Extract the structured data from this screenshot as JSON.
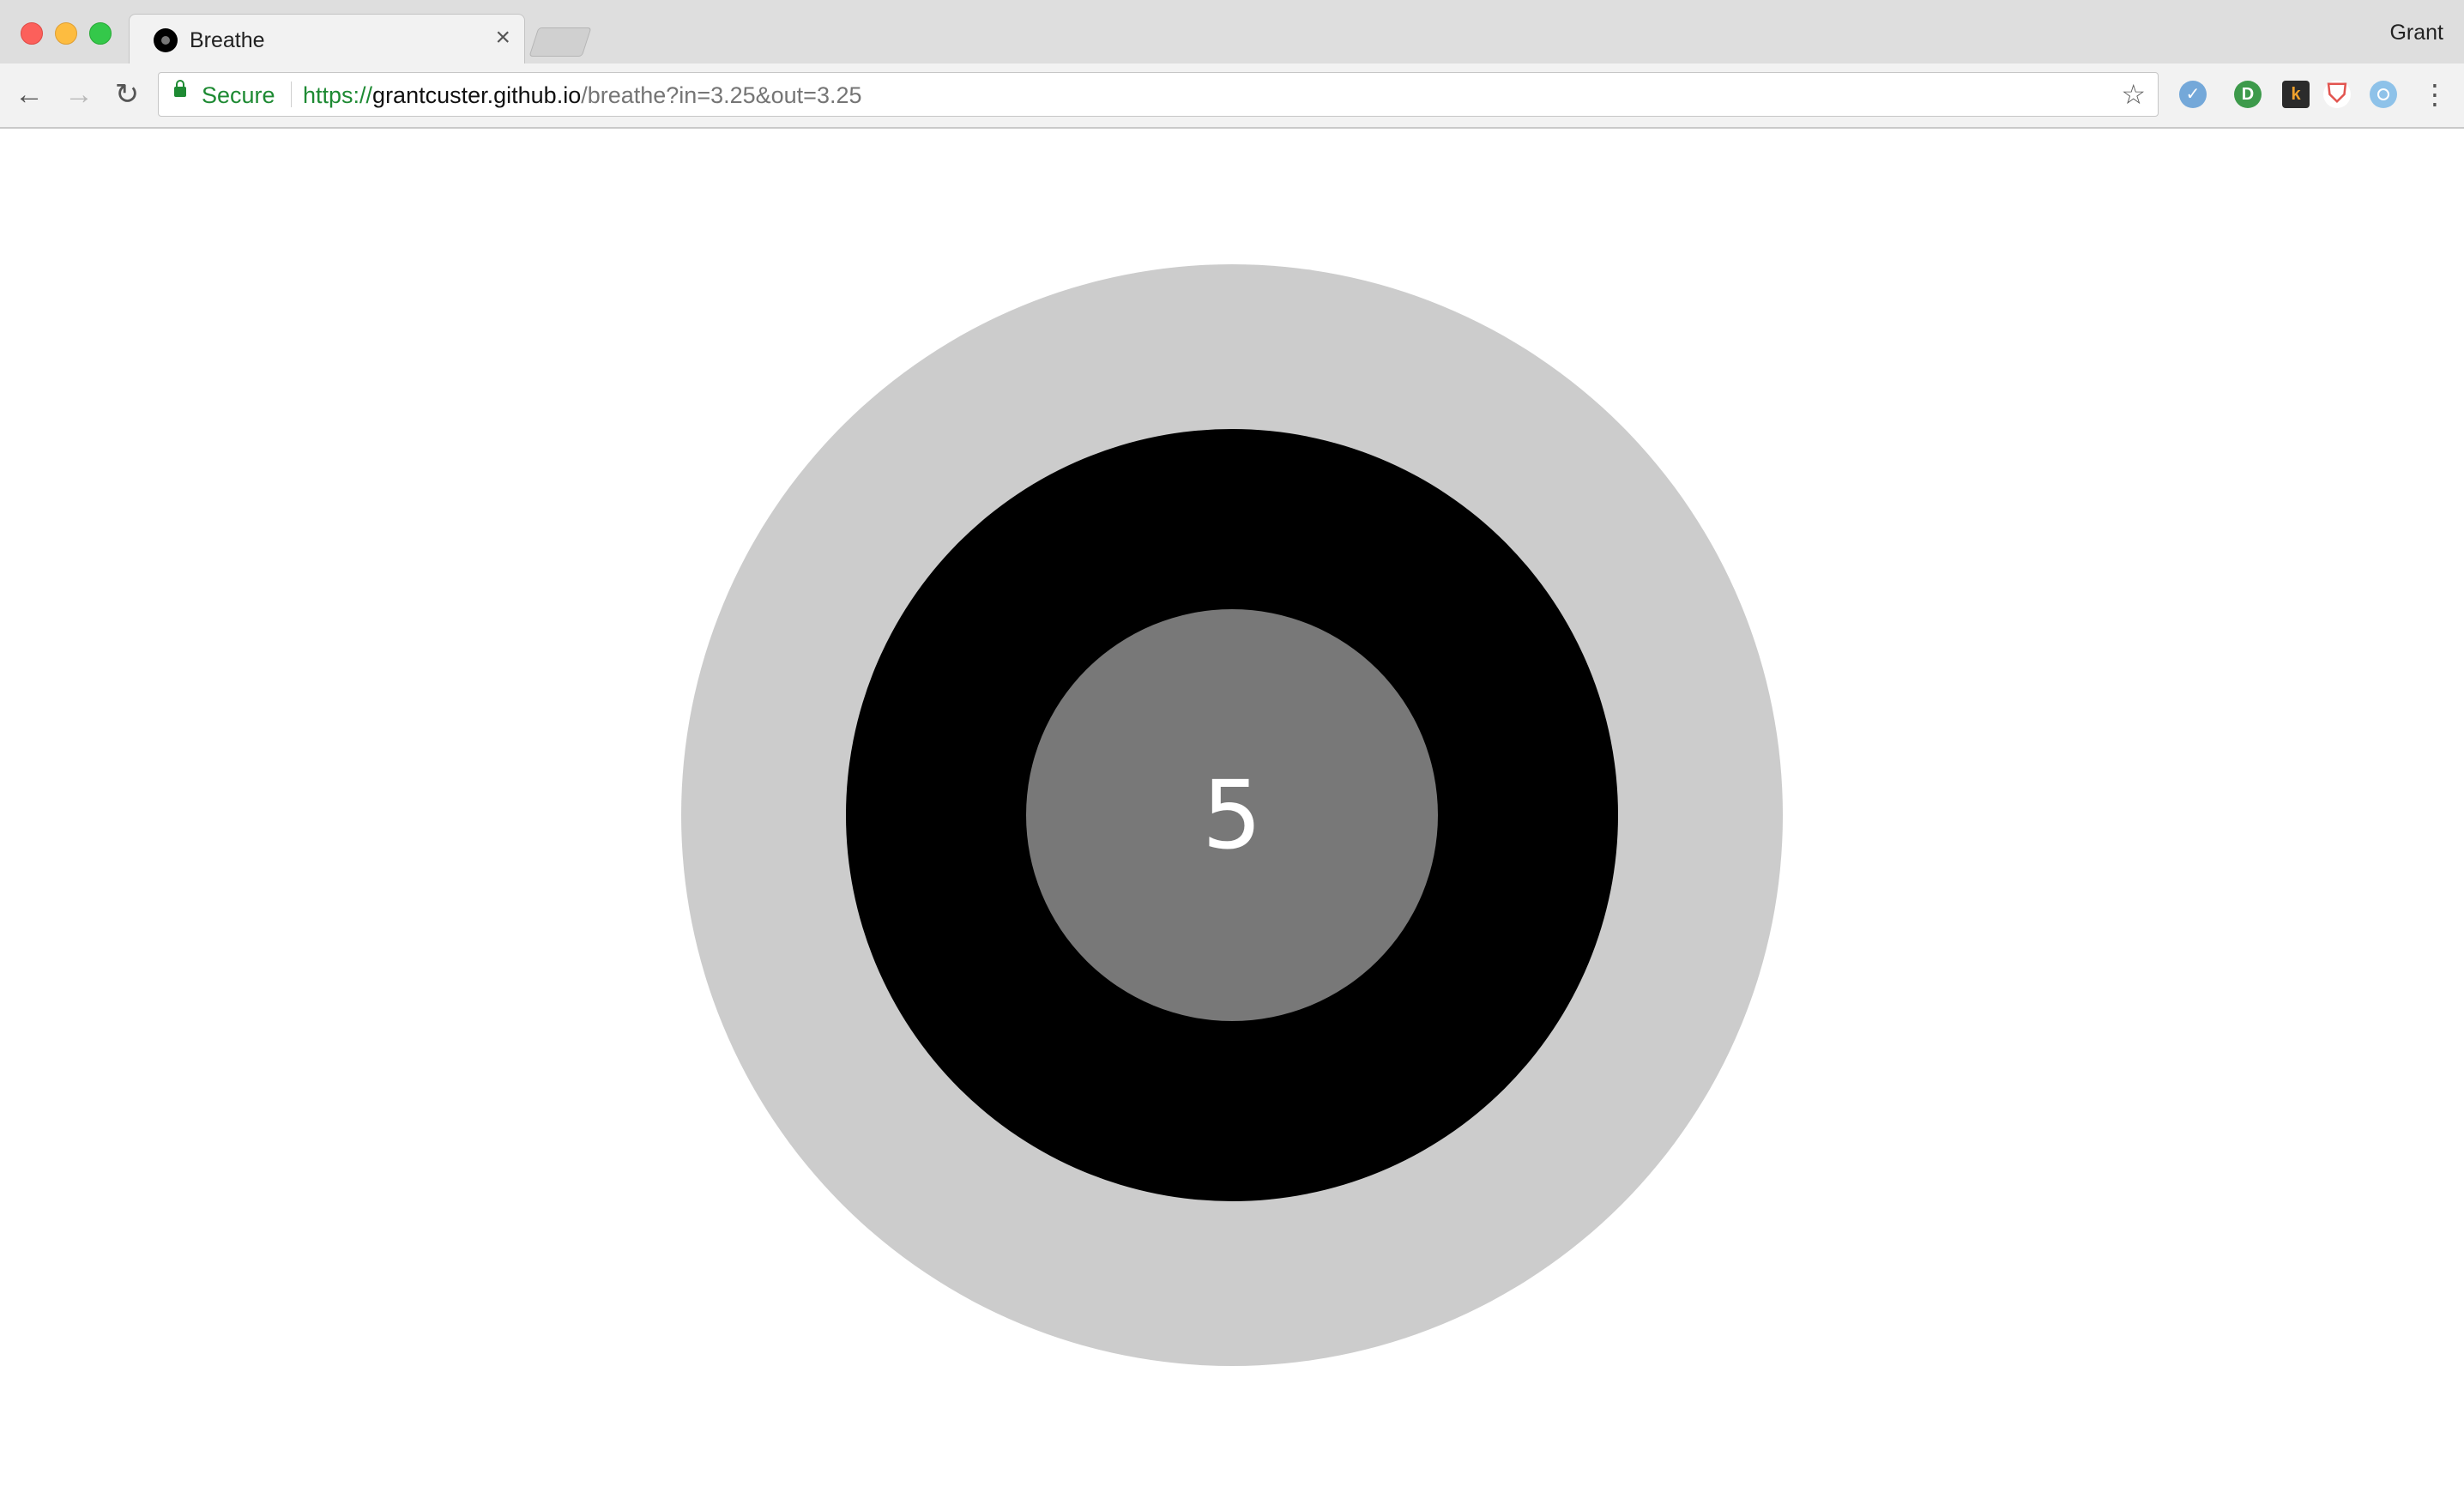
{
  "window": {
    "profile_name": "Grant"
  },
  "tab": {
    "title": "Breathe",
    "close_glyph": "×",
    "favicon": "breathe-favicon"
  },
  "toolbar": {
    "back_glyph": "←",
    "forward_glyph": "→",
    "reload_glyph": "↻",
    "secure_label": "Secure",
    "url_scheme": "https://",
    "url_host": "grantcuster.github.io",
    "url_path": "/breathe?in=3.25&out=3.25",
    "star_glyph": "☆",
    "menu_glyph": "⋮",
    "extensions": [
      {
        "name": "feedly-icon",
        "glyph": "✓",
        "color": "#74a8d9"
      },
      {
        "name": "grammar-icon",
        "glyph": "D",
        "color": "#3d9a4b"
      },
      {
        "name": "k-icon",
        "glyph": "k",
        "color": "#2b2b2b"
      },
      {
        "name": "shield-icon",
        "glyph": "⛉",
        "color": "#e25550"
      },
      {
        "name": "circle-icon",
        "glyph": "",
        "color": "#8ec2e9"
      }
    ]
  },
  "breathe": {
    "counter": "5",
    "colors": {
      "outer": "#cccccc",
      "middle": "#000000",
      "inner": "#787878",
      "text": "#ffffff"
    }
  }
}
